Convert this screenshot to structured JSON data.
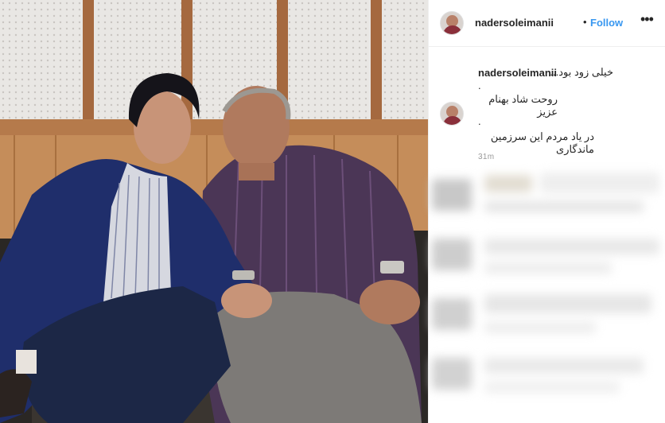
{
  "post": {
    "photo_alt": "photo",
    "author": "nadersoleimanii",
    "follow_label": "Follow",
    "separator": "•",
    "more_icon": "more-options-icon",
    "caption": {
      "user": "nadersoleimanii",
      "line1": "خیلی زود بود...",
      "dot1": ".",
      "line2": "روحت شاد بهنام عزیز",
      "dot2": ".",
      "line3": "در یاد مردم این سرزمین ماندگاری"
    },
    "time": "31m"
  },
  "colors": {
    "link": "#3897f0",
    "text": "#262626",
    "muted": "#999999"
  }
}
